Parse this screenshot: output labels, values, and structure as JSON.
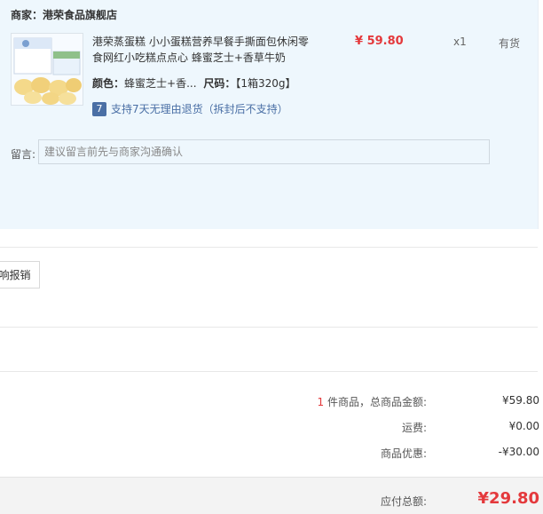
{
  "merchant": {
    "label": "商家：",
    "name": "港荣食品旗舰店"
  },
  "product": {
    "title": "港荣蒸蛋糕 小小蛋糕营养早餐手撕面包休闲零食网红小吃糕点点心 蜂蜜芝士+香草牛奶",
    "price": "¥ 59.80",
    "quantity": "x1",
    "stock": "有货",
    "color_label": "颜色：",
    "color_value": "蜂蜜芝士+香...",
    "size_label": "尺码：",
    "size_value": "【1箱320g】",
    "return_icon_text": "7",
    "return_policy": "支持7天无理由退货（拆封后不支持）"
  },
  "note": {
    "label": "留言:",
    "placeholder": "建议留言前先与商家沟通确认"
  },
  "receipt": {
    "button_label": "响报销"
  },
  "summary": {
    "count": "1",
    "count_suffix": " 件商品，总商品金额:",
    "goods_amount": "¥59.80",
    "shipping_label": "运费:",
    "shipping_amount": "¥0.00",
    "discount_label": "商品优惠:",
    "discount_amount": "-¥30.00",
    "total_label": "应付总额:",
    "total_amount": "¥29.80"
  },
  "colors": {
    "accent": "#e4393c",
    "link": "#4a6fa5",
    "panel": "#eef7fd"
  }
}
